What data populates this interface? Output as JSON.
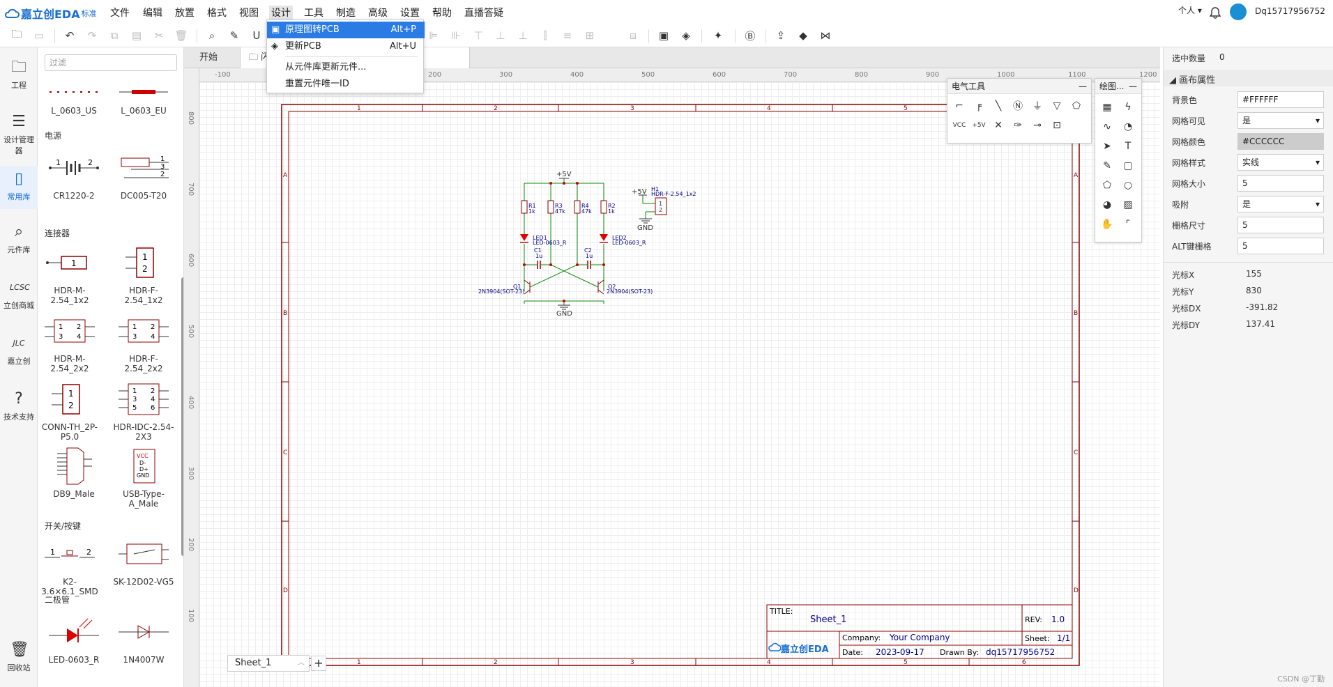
{
  "app": {
    "logo_text": "嘉立创EDA",
    "logo_edition": "标准"
  },
  "menus": [
    "文件",
    "编辑",
    "放置",
    "格式",
    "视图",
    "设计",
    "工具",
    "制造",
    "高级",
    "设置",
    "帮助",
    "直播答疑"
  ],
  "user": {
    "mode": "个人",
    "name": "Dq15717956752"
  },
  "design_menu": {
    "items": [
      {
        "label": "原理图转PCB",
        "shortcut": "Alt+P"
      },
      {
        "label": "更新PCB",
        "shortcut": "Alt+U"
      },
      {
        "label": "从元件库更新元件...",
        "shortcut": ""
      },
      {
        "label": "重置元件唯一ID",
        "shortcut": ""
      }
    ]
  },
  "leftnav": [
    {
      "label": "工程",
      "icon": "folder-icon"
    },
    {
      "label": "设计管理器",
      "icon": "list-icon"
    },
    {
      "label": "常用库",
      "icon": "chip-icon"
    },
    {
      "label": "元件库",
      "icon": "search-icon"
    },
    {
      "label": "立创商城",
      "icon": "lcsc-icon"
    },
    {
      "label": "嘉立创",
      "icon": "jlc-icon"
    },
    {
      "label": "技术支持",
      "icon": "help-icon"
    },
    {
      "label": "回收站",
      "icon": "trash-icon"
    }
  ],
  "library": {
    "filter_placeholder": "过滤",
    "categories": {
      "power": "电源",
      "connector": "连接器",
      "switch": "开关/按键",
      "diode": "二极管"
    },
    "components": {
      "l0603us": "L_0603_US",
      "l0603eu": "L_0603_EU",
      "cr1220": "CR1220-2",
      "dc005": "DC005-T20",
      "hdrm1x2": "HDR-M-2.54_1x2",
      "hdrf1x2": "HDR-F-2.54_1x2",
      "hdrm2x2": "HDR-M-2.54_2x2",
      "hdrf2x2": "HDR-F-2.54_2x2",
      "connth": "CONN-TH_2P-P5.0",
      "idc": "HDR-IDC-2.54-2X3",
      "db9": "DB9_Male",
      "usba": "USB-Type-A_Male",
      "k2": "K2-3.6×6.1_SMD",
      "sk12": "SK-12D02-VG5",
      "led": "LED-0603_R",
      "n4007": "1N4007W"
    }
  },
  "tabs": {
    "start": "开始",
    "doc": "闪"
  },
  "ruler": {
    "x": [
      "-100",
      "0",
      "100",
      "200",
      "300",
      "400",
      "500",
      "600",
      "700",
      "800",
      "900",
      "1000",
      "1100",
      "1200"
    ],
    "y": [
      "800",
      "700",
      "600",
      "500",
      "400",
      "300",
      "200",
      "100"
    ]
  },
  "frame": {
    "cols": [
      "1",
      "2",
      "3",
      "4",
      "5",
      "6"
    ],
    "rows": [
      "A",
      "B",
      "C",
      "D"
    ]
  },
  "titleblock": {
    "title_label": "TITLE:",
    "title": "Sheet_1",
    "rev_label": "REV:",
    "rev": "1.0",
    "company_label": "Company:",
    "company": "Your Company",
    "sheet_label": "Sheet:",
    "sheet": "1/1",
    "date_label": "Date:",
    "date": "2023-09-17",
    "drawn_label": "Drawn By:",
    "drawn": "dq15717956752",
    "logo": "嘉立创EDA"
  },
  "schematic": {
    "vcc": "+5V",
    "gnd": "GND",
    "r1": "R1",
    "r1v": "1k",
    "r2": "R2",
    "r2v": "1k",
    "r3": "R3",
    "r3v": "47k",
    "r4": "R4",
    "r4v": "47k",
    "led1": "LED1",
    "led1v": "LED-0603_R",
    "led2": "LED2",
    "led2v": "LED-0603_R",
    "c1": "C1",
    "c1v": "1u",
    "c2": "C2",
    "c2v": "1u",
    "q1": "Q1",
    "q1v": "2N3904(SOT-23)",
    "q2": "Q2",
    "q2v": "2N3904(SOT-23)",
    "h1": "H1",
    "h1v": "HDR-F-2.54_1x2",
    "pin1": "1",
    "pin2": "2"
  },
  "panels": {
    "electrical": "电气工具",
    "drawing": "绘图..."
  },
  "sheet_tab": "Sheet_1",
  "properties": {
    "selected_label": "选中数量",
    "selected": "0",
    "section": "画布属性",
    "rows": [
      {
        "label": "背景色",
        "value": "#FFFFFF",
        "type": "input"
      },
      {
        "label": "网格可见",
        "value": "是",
        "type": "select"
      },
      {
        "label": "网格颜色",
        "value": "#CCCCCC",
        "type": "color"
      },
      {
        "label": "网格样式",
        "value": "实线",
        "type": "select"
      },
      {
        "label": "网格大小",
        "value": "5",
        "type": "input"
      },
      {
        "label": "吸附",
        "value": "是",
        "type": "select"
      },
      {
        "label": "栅格尺寸",
        "value": "5",
        "type": "input"
      },
      {
        "label": "ALT键栅格",
        "value": "5",
        "type": "input"
      }
    ],
    "cursor": [
      {
        "label": "光标X",
        "value": "155"
      },
      {
        "label": "光标Y",
        "value": "830"
      },
      {
        "label": "光标DX",
        "value": "-391.82"
      },
      {
        "label": "光标DY",
        "value": "137.41"
      }
    ]
  },
  "watermark": "CSDN @丁勤"
}
